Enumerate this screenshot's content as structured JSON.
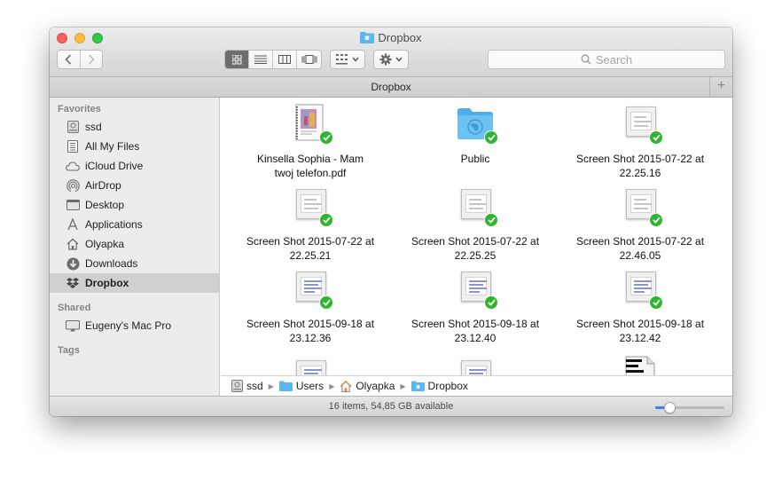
{
  "window": {
    "title": "Dropbox",
    "search_placeholder": "Search",
    "path_tab_title": "Dropbox",
    "path_tab_plus": "+"
  },
  "sidebar": {
    "favorites_label": "Favorites",
    "favorites": [
      {
        "label": "ssd",
        "icon": "drive-icon"
      },
      {
        "label": "All My Files",
        "icon": "all-files-icon"
      },
      {
        "label": "iCloud Drive",
        "icon": "cloud-icon"
      },
      {
        "label": "AirDrop",
        "icon": "airdrop-icon"
      },
      {
        "label": "Desktop",
        "icon": "desktop-icon"
      },
      {
        "label": "Applications",
        "icon": "applications-icon"
      },
      {
        "label": "Olyapka",
        "icon": "home-icon"
      },
      {
        "label": "Downloads",
        "icon": "downloads-icon"
      },
      {
        "label": "Dropbox",
        "icon": "dropbox-icon",
        "active": true
      }
    ],
    "shared_label": "Shared",
    "shared": [
      {
        "label": "Eugeny's Mac Pro",
        "icon": "computer-icon"
      }
    ],
    "tags_label": "Tags"
  },
  "files": [
    {
      "line1": "Kinsella Sophia - Mam",
      "line2": "twoj telefon.pdf",
      "type": "pdf"
    },
    {
      "line1": "Public",
      "line2": "",
      "type": "folder"
    },
    {
      "line1": "Screen Shot 2015-07-22 at",
      "line2": "22.25.16",
      "type": "screenshot"
    },
    {
      "line1": "Screen Shot 2015-07-22 at",
      "line2": "22.25.21",
      "type": "screenshot"
    },
    {
      "line1": "Screen Shot 2015-07-22 at",
      "line2": "22.25.25",
      "type": "screenshot"
    },
    {
      "line1": "Screen Shot 2015-07-22 at",
      "line2": "22.46.05",
      "type": "screenshot"
    },
    {
      "line1": "Screen Shot 2015-09-18 at",
      "line2": "23.12.36",
      "type": "screenshot-blue"
    },
    {
      "line1": "Screen Shot 2015-09-18 at",
      "line2": "23.12.40",
      "type": "screenshot-blue"
    },
    {
      "line1": "Screen Shot 2015-09-18 at",
      "line2": "23.12.42",
      "type": "screenshot-blue"
    }
  ],
  "pathbar": [
    "ssd",
    "Users",
    "Olyapka",
    "Dropbox"
  ],
  "status": {
    "text": "16 items, 54,85 GB available",
    "icon_size_fraction": 0.2
  },
  "colors": {
    "sync_check": "#2fb52f",
    "folder_blue": "#5bb8ef",
    "slider_accent": "#3b82f0"
  }
}
